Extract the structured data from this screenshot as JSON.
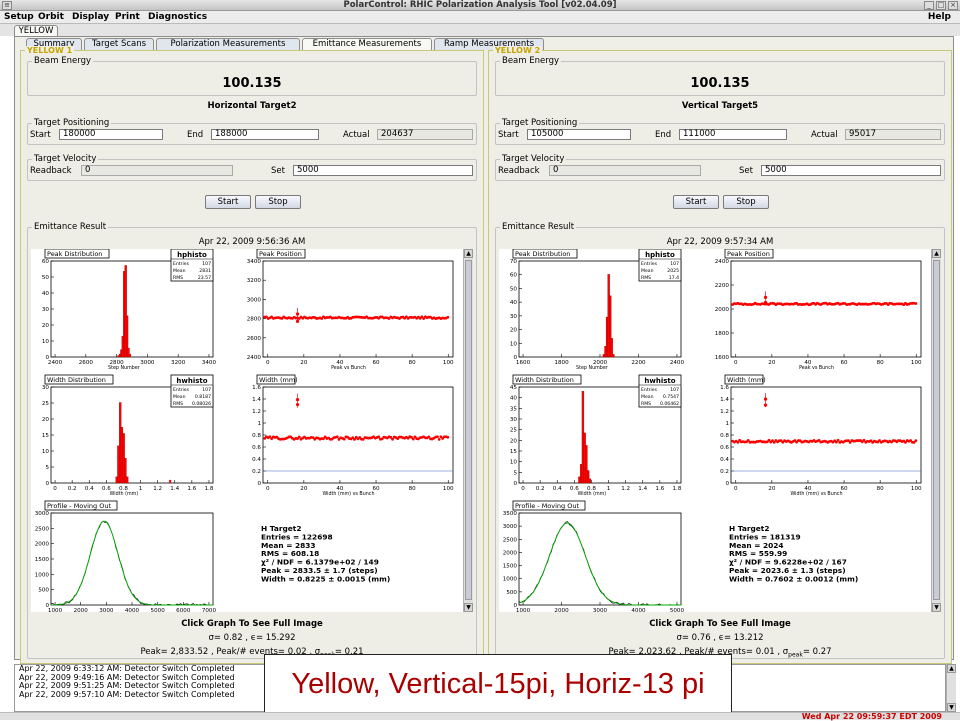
{
  "window": {
    "title": "PolarControl: RHIC Polarization Analysis Tool [v02.04.09]"
  },
  "menu": {
    "items": [
      "Setup",
      "Orbit",
      "Display",
      "Print",
      "Diagnostics"
    ],
    "help": "Help"
  },
  "ring_tab": "YELLOW",
  "tabs": [
    "Summary",
    "Target Scans",
    "Polarization Measurements",
    "Emittance Measurements",
    "Ramp Measurements"
  ],
  "panels": [
    {
      "title": "YELLOW 1",
      "beam_energy_label": "Beam Energy",
      "beam_energy": "100.135",
      "target_name": "Horizontal Target2",
      "positioning_label": "Target Positioning",
      "start_label": "Start",
      "start": "180000",
      "end_label": "End",
      "end": "188000",
      "actual_label": "Actual",
      "actual": "204637",
      "velocity_label": "Target Velocity",
      "readback_label": "Readback",
      "readback": "0",
      "set_label": "Set",
      "set": "5000",
      "start_button": "Start",
      "stop_button": "Stop",
      "result_label": "Emittance Result",
      "timestamp": "Apr 22, 2009 9:56:36 AM",
      "click_text": "Click Graph To See Full Image",
      "sigma_line": "σ= 0.82 , ϵ= 15.292",
      "peak_line_a": "Peak= 2,833.52 , Peak/# events= 0.02 , σ",
      "peak_sub": "peak",
      "peak_line_b": "= 0.21",
      "plots": {
        "peak_dist": {
          "title": "Peak Distribution",
          "stats_name": "hphisto",
          "entries_label": "Entries",
          "entries": "107",
          "mean_label": "Mean",
          "mean": "2831",
          "rms_label": "RMS",
          "rms": "23.57",
          "xticks": [
            "2400",
            "2600",
            "2800",
            "3000",
            "3200",
            "3400"
          ],
          "yticks": [
            "0",
            "10",
            "20",
            "30",
            "40",
            "50",
            "60"
          ],
          "xlabel": "Step Number"
        },
        "peak_pos": {
          "title": "Peak Position",
          "yticks": [
            "2400",
            "2600",
            "2800",
            "3000",
            "3200",
            "3400"
          ],
          "xticks": [
            "0",
            "20",
            "40",
            "60",
            "80",
            "100"
          ],
          "xlabel": "Peak vs Bunch"
        },
        "width_dist": {
          "title": "Width Distribution",
          "stats_name": "hwhisto",
          "entries_label": "Entries",
          "entries": "107",
          "mean_label": "Mean",
          "mean": "0.8187",
          "rms_label": "RMS",
          "rms": "0.08026",
          "xticks": [
            "0",
            "0.2",
            "0.4",
            "0.6",
            "0.8",
            "1",
            "1.2",
            "1.4",
            "1.6",
            "1.8"
          ],
          "yticks": [
            "0",
            "5",
            "10",
            "15",
            "20",
            "25",
            "30"
          ],
          "xlabel": "Width (mm)"
        },
        "width": {
          "title": "Width (mm)",
          "yticks": [
            "0",
            "0.2",
            "0.4",
            "0.6",
            "0.8",
            "1",
            "1.2",
            "1.4",
            "1.6"
          ],
          "xticks": [
            "0",
            "20",
            "40",
            "60",
            "80",
            "100"
          ],
          "xlabel": "Width (mm) vs Bunch"
        },
        "profile": {
          "title": "Profile - Moving Out",
          "yticks": [
            "0",
            "500",
            "1000",
            "1500",
            "2000",
            "2500",
            "3000"
          ],
          "xticks": [
            "1000",
            "2000",
            "3000",
            "4000",
            "5000",
            "6000",
            "7000"
          ],
          "xlabel": "Profile - Moving Out"
        }
      },
      "fit": {
        "name": "H Target2",
        "entries": "Entries = 122698",
        "mean": "Mean =    2833",
        "rms": "RMS =    608.18",
        "chi": "χ² / NDF = 6.1379e+02 / 149",
        "peak": "Peak =    2833.5 ±    1.7 (steps)",
        "width": "Width =   0.8225 ±  0.0015 (mm)"
      }
    },
    {
      "title": "YELLOW 2",
      "beam_energy_label": "Beam Energy",
      "beam_energy": "100.135",
      "target_name": "Vertical Target5",
      "positioning_label": "Target Positioning",
      "start_label": "Start",
      "start": "105000",
      "end_label": "End",
      "end": "111000",
      "actual_label": "Actual",
      "actual": "95017",
      "velocity_label": "Target Velocity",
      "readback_label": "Readback",
      "readback": "0",
      "set_label": "Set",
      "set": "5000",
      "start_button": "Start",
      "stop_button": "Stop",
      "result_label": "Emittance Result",
      "timestamp": "Apr 22, 2009 9:57:34 AM",
      "click_text": "Click Graph To See Full Image",
      "sigma_line": "σ= 0.76 , ϵ= 13.212",
      "peak_line_a": "Peak= 2,023.62 , Peak/# events= 0.01 , σ",
      "peak_sub": "peak",
      "peak_line_b": "= 0.27",
      "plots": {
        "peak_dist": {
          "title": "Peak Distribution",
          "stats_name": "hphisto",
          "entries_label": "Entries",
          "entries": "107",
          "mean_label": "Mean",
          "mean": "2025",
          "rms_label": "RMS",
          "rms": "17.4",
          "xticks": [
            "1600",
            "1800",
            "2000",
            "2200",
            "2400"
          ],
          "yticks": [
            "0",
            "10",
            "20",
            "30",
            "40",
            "50",
            "60",
            "70"
          ],
          "xlabel": "Step Number"
        },
        "peak_pos": {
          "title": "Peak Position",
          "yticks": [
            "1600",
            "1800",
            "2000",
            "2200",
            "2400"
          ],
          "xticks": [
            "0",
            "20",
            "40",
            "60",
            "80",
            "100"
          ],
          "xlabel": "Peak vs Bunch"
        },
        "width_dist": {
          "title": "Width Distribution",
          "stats_name": "hwhisto",
          "entries_label": "Entries",
          "entries": "107",
          "mean_label": "Mean",
          "mean": "0.7547",
          "rms_label": "RMS",
          "rms": "0.06462",
          "xticks": [
            "0",
            "0.2",
            "0.4",
            "0.6",
            "0.8",
            "1",
            "1.2",
            "1.4",
            "1.6",
            "1.8"
          ],
          "yticks": [
            "0",
            "5",
            "10",
            "15",
            "20",
            "25",
            "30",
            "35",
            "40",
            "45"
          ],
          "xlabel": "Width (mm)"
        },
        "width": {
          "title": "Width (mm)",
          "yticks": [
            "0",
            "0.2",
            "0.4",
            "0.6",
            "0.8",
            "1",
            "1.2",
            "1.4",
            "1.6"
          ],
          "xticks": [
            "0",
            "20",
            "40",
            "60",
            "80",
            "100"
          ],
          "xlabel": "Width (mm) vs Bunch"
        },
        "profile": {
          "title": "Profile - Moving Out",
          "yticks": [
            "0",
            "500",
            "1000",
            "1500",
            "2000",
            "2500",
            "3000",
            "3500"
          ],
          "xticks": [
            "1000",
            "2000",
            "3000",
            "4000",
            "5000"
          ],
          "xlabel": "Profile - Moving Out"
        }
      },
      "fit": {
        "name": "H Target2",
        "entries": "Entries = 181319",
        "mean": "Mean =    2024",
        "rms": "RMS =    559.99",
        "chi": "χ² / NDF = 9.6228e+02 / 167",
        "peak": "Peak =    2023.6 ±    1.3 (steps)",
        "width": "Width =   0.7602 ±  0.0012 (mm)"
      }
    }
  ],
  "log": [
    "Apr 22, 2009 6:33:12 AM: Detector Switch Completed",
    "Apr 22, 2009 9:49:16 AM: Detector Switch Completed",
    "Apr 22, 2009 9:51:25 AM: Detector Switch Completed",
    "Apr 22, 2009 9:57:10 AM: Detector Switch Completed"
  ],
  "annotation": "Yellow, Vertical-15pi, Horiz-13 pi",
  "clock": "Wed Apr 22 09:59:37 EDT 2009",
  "colors": {
    "marker": "#ff0000",
    "fit": "#00aa00",
    "panel_border": "#c8c879",
    "annotation": "#aa0000"
  },
  "chart_data": [
    {
      "type": "bar",
      "title": "Peak Distribution",
      "panel": 0,
      "x": [
        2780,
        2790,
        2800,
        2810,
        2820,
        2830,
        2840,
        2850,
        2860
      ],
      "values": [
        1,
        2,
        5,
        14,
        58,
        62,
        28,
        6,
        2
      ],
      "xlim": [
        2300,
        3450
      ],
      "ylim": [
        0,
        65
      ]
    },
    {
      "type": "scatter",
      "title": "Peak Position",
      "panel": 0,
      "xlim": [
        0,
        110
      ],
      "ylim": [
        2400,
        3450
      ],
      "level": 2830,
      "spread": 10,
      "outliers": [
        [
          20,
          2870
        ],
        [
          20,
          2790
        ]
      ]
    },
    {
      "type": "bar",
      "title": "Width Distribution",
      "panel": 0,
      "x": [
        0.75,
        0.77,
        0.79,
        0.81,
        0.83,
        0.85,
        0.87
      ],
      "values": [
        2,
        12,
        26,
        18,
        16,
        8,
        2
      ],
      "xlim": [
        0,
        1.85
      ],
      "ylim": [
        0,
        31
      ],
      "extra": [
        [
          1.36,
          1
        ]
      ]
    },
    {
      "type": "scatter",
      "title": "Width (mm)",
      "panel": 0,
      "xlim": [
        0,
        110
      ],
      "ylim": [
        0,
        1.75
      ],
      "level": 0.82,
      "spread": 0.025,
      "outliers": [
        [
          20,
          1.43
        ],
        [
          20,
          1.52
        ]
      ]
    },
    {
      "type": "line",
      "title": "Profile - Moving Out",
      "panel": 0,
      "xlim": [
        500,
        7600
      ],
      "ylim": [
        0,
        3400
      ],
      "mean": 2833,
      "sigma": 608,
      "peak": 3100
    },
    {
      "type": "bar",
      "title": "Peak Distribution",
      "panel": 1,
      "x": [
        1990,
        2000,
        2010,
        2020,
        2030,
        2040,
        2050
      ],
      "values": [
        2,
        8,
        30,
        62,
        46,
        14,
        2
      ],
      "xlim": [
        1450,
        2480
      ],
      "ylim": [
        0,
        72
      ]
    },
    {
      "type": "scatter",
      "title": "Peak Position",
      "panel": 1,
      "xlim": [
        0,
        110
      ],
      "ylim": [
        1500,
        2450
      ],
      "level": 2025,
      "spread": 8,
      "outliers": [
        [
          20,
          2090
        ],
        [
          20,
          2040
        ]
      ]
    },
    {
      "type": "bar",
      "title": "Width Distribution",
      "panel": 1,
      "x": [
        0.69,
        0.71,
        0.73,
        0.75,
        0.77,
        0.79,
        0.81
      ],
      "values": [
        3,
        9,
        44,
        24,
        18,
        6,
        2
      ],
      "xlim": [
        0,
        1.85
      ],
      "ylim": [
        0,
        46
      ]
    },
    {
      "type": "scatter",
      "title": "Width (mm)",
      "panel": 1,
      "xlim": [
        0,
        110
      ],
      "ylim": [
        0,
        1.75
      ],
      "level": 0.76,
      "spread": 0.02,
      "outliers": [
        [
          20,
          1.42
        ],
        [
          20,
          1.53
        ]
      ]
    },
    {
      "type": "line",
      "title": "Profile - Moving Out",
      "panel": 1,
      "xlim": [
        500,
        5600
      ],
      "ylim": [
        0,
        3700
      ],
      "mean": 2024,
      "sigma": 560,
      "peak": 3300
    }
  ]
}
